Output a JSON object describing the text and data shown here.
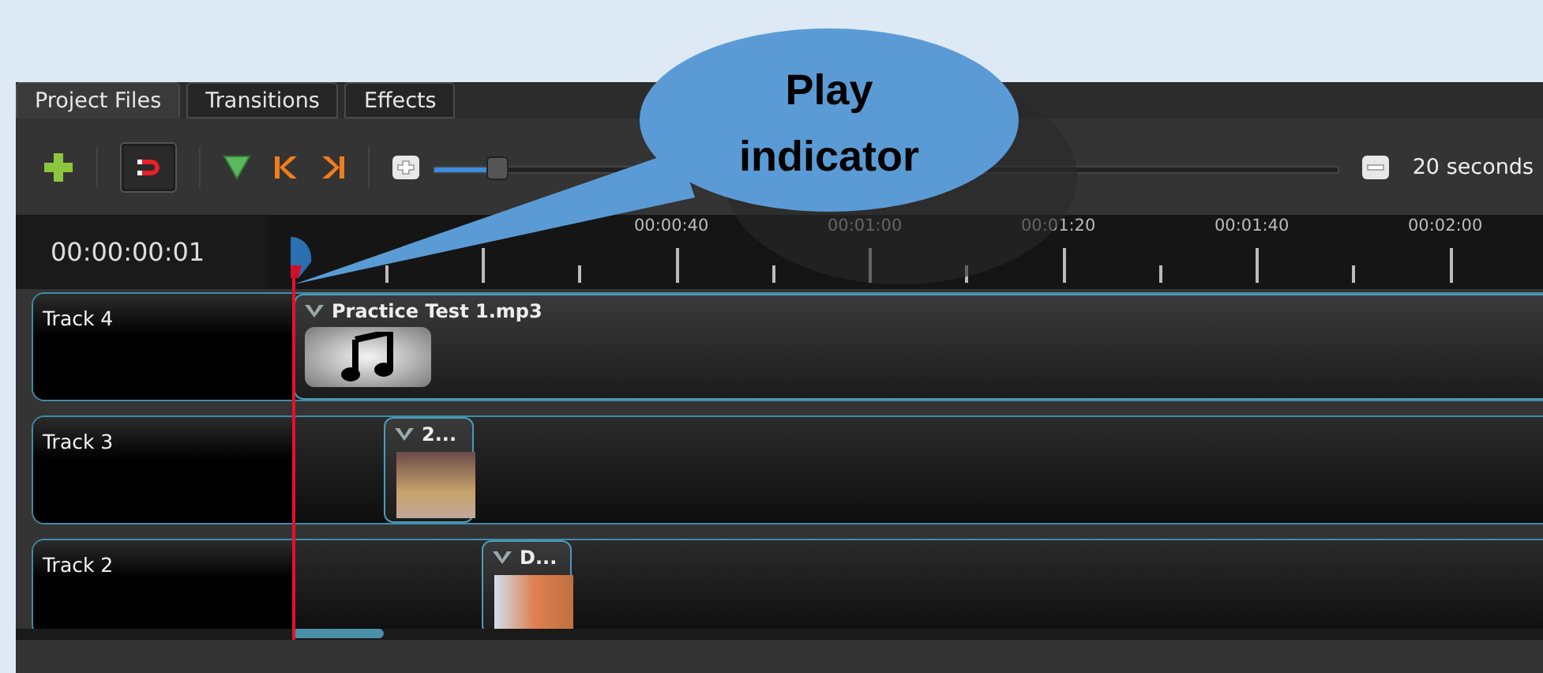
{
  "tabs": [
    {
      "label": "Project Files",
      "selected": true
    },
    {
      "label": "Transitions",
      "selected": false
    },
    {
      "label": "Effects",
      "selected": false
    }
  ],
  "toolbar": {
    "snap": {
      "on": true
    },
    "zoom": {
      "level": 0.07
    },
    "zoom_label": "20 seconds"
  },
  "timeline": {
    "current_time": "00:00:00:01",
    "ruler_labels": [
      "00:00:40",
      "00:01:00",
      "00:01:20",
      "00:01:40",
      "00:02:00"
    ],
    "tracks": [
      {
        "name": "Track 4",
        "clips": [
          {
            "title": "Practice Test 1.mp3",
            "kind": "audio"
          }
        ]
      },
      {
        "name": "Track 3",
        "clips": [
          {
            "title": "2...",
            "kind": "image"
          }
        ]
      },
      {
        "name": "Track 2",
        "clips": [
          {
            "title": "D...",
            "kind": "image"
          }
        ]
      }
    ]
  },
  "callout": {
    "text": "Play indicator"
  }
}
